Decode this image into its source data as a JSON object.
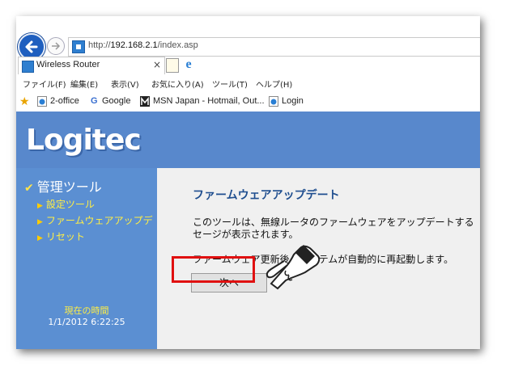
{
  "browser": {
    "url_prefix": "http://",
    "url_host": "192.168.2.1",
    "url_path": "/index.asp",
    "tab_title": "Wireless Router",
    "tab_close": "×",
    "menu": [
      "ファイル(F)",
      "編集(E)",
      "表示(V)",
      "お気に入り(A)",
      "ツール(T)",
      "ヘルプ(H)"
    ],
    "favorites": [
      "2-office",
      "Google",
      "MSN Japan - Hotmail, Out...",
      "Login"
    ]
  },
  "page": {
    "logo": "Logitec",
    "sidebar": {
      "heading": "管理ツール",
      "links": [
        "設定ツール",
        "ファームウェアアップデ",
        "リセット"
      ],
      "time_label": "現在の時間",
      "time_value": "1/1/2012 6:22:25"
    },
    "content": {
      "title": "ファームウェアアップデート",
      "line1": "このツールは、無線ルータのファームウェアをアップデートする",
      "line2": "セージが表示されます。",
      "line3": "ファームウェア更新後、システムが自動的に再起動します。",
      "next_button": "次へ"
    }
  },
  "colors": {
    "accent_blue": "#5888cc",
    "sidebar_link": "#ffee44",
    "title_blue": "#1f4e8f",
    "highlight_red": "#e01010"
  }
}
